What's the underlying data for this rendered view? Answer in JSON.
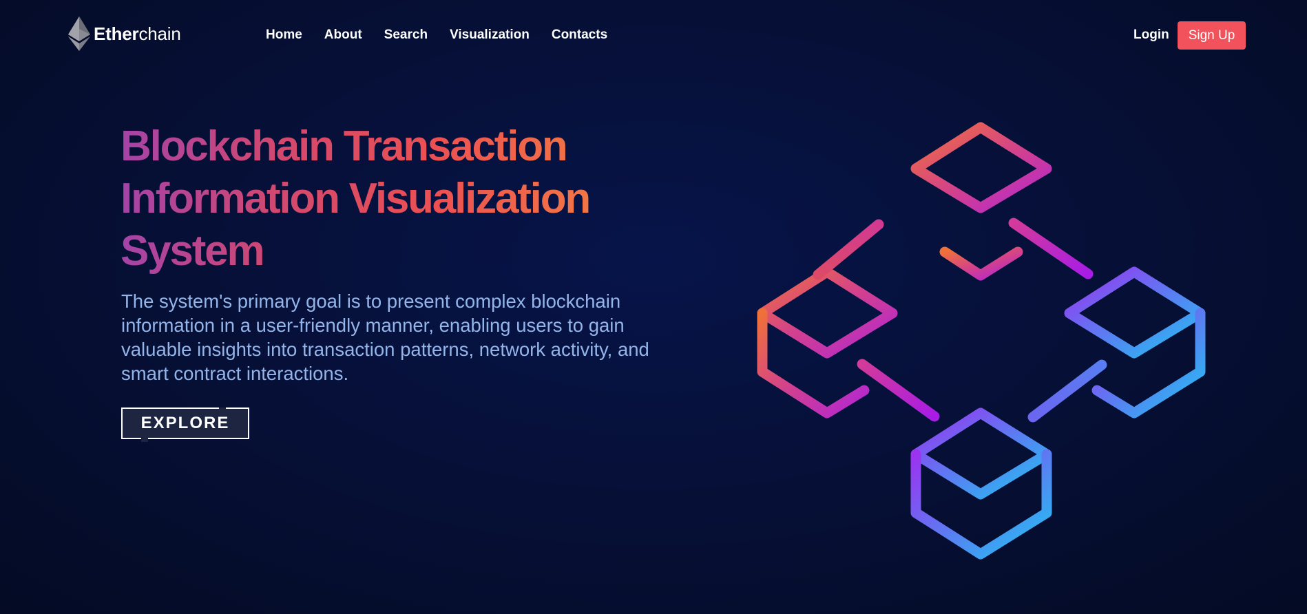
{
  "brand": {
    "name_bold": "Ether",
    "name_light": "chain",
    "icon": "ethereum-diamond-icon"
  },
  "nav": {
    "items": [
      {
        "label": "Home"
      },
      {
        "label": "About"
      },
      {
        "label": "Search"
      },
      {
        "label": "Visualization"
      },
      {
        "label": "Contacts"
      }
    ],
    "login_label": "Login",
    "signup_label": "Sign Up"
  },
  "hero": {
    "title_lines": [
      "Blockchain Transaction",
      "Information Visualization",
      "System"
    ],
    "description": "The system's primary goal is to present complex blockchain information in a user-friendly manner, enabling users to gain valuable insights into transaction patterns, network activity, and smart contract interactions.",
    "cta_label": "EXPLORE",
    "illustration_icon": "blockchain-cubes-icon"
  },
  "colors": {
    "background": "#06113a",
    "accent": "#f1525b",
    "description_text": "#93b5ea",
    "gradient_orange": "#f5833f",
    "gradient_purple": "#a543a8",
    "gradient_cyan": "#20c5f2",
    "gradient_violet": "#b020f0"
  }
}
